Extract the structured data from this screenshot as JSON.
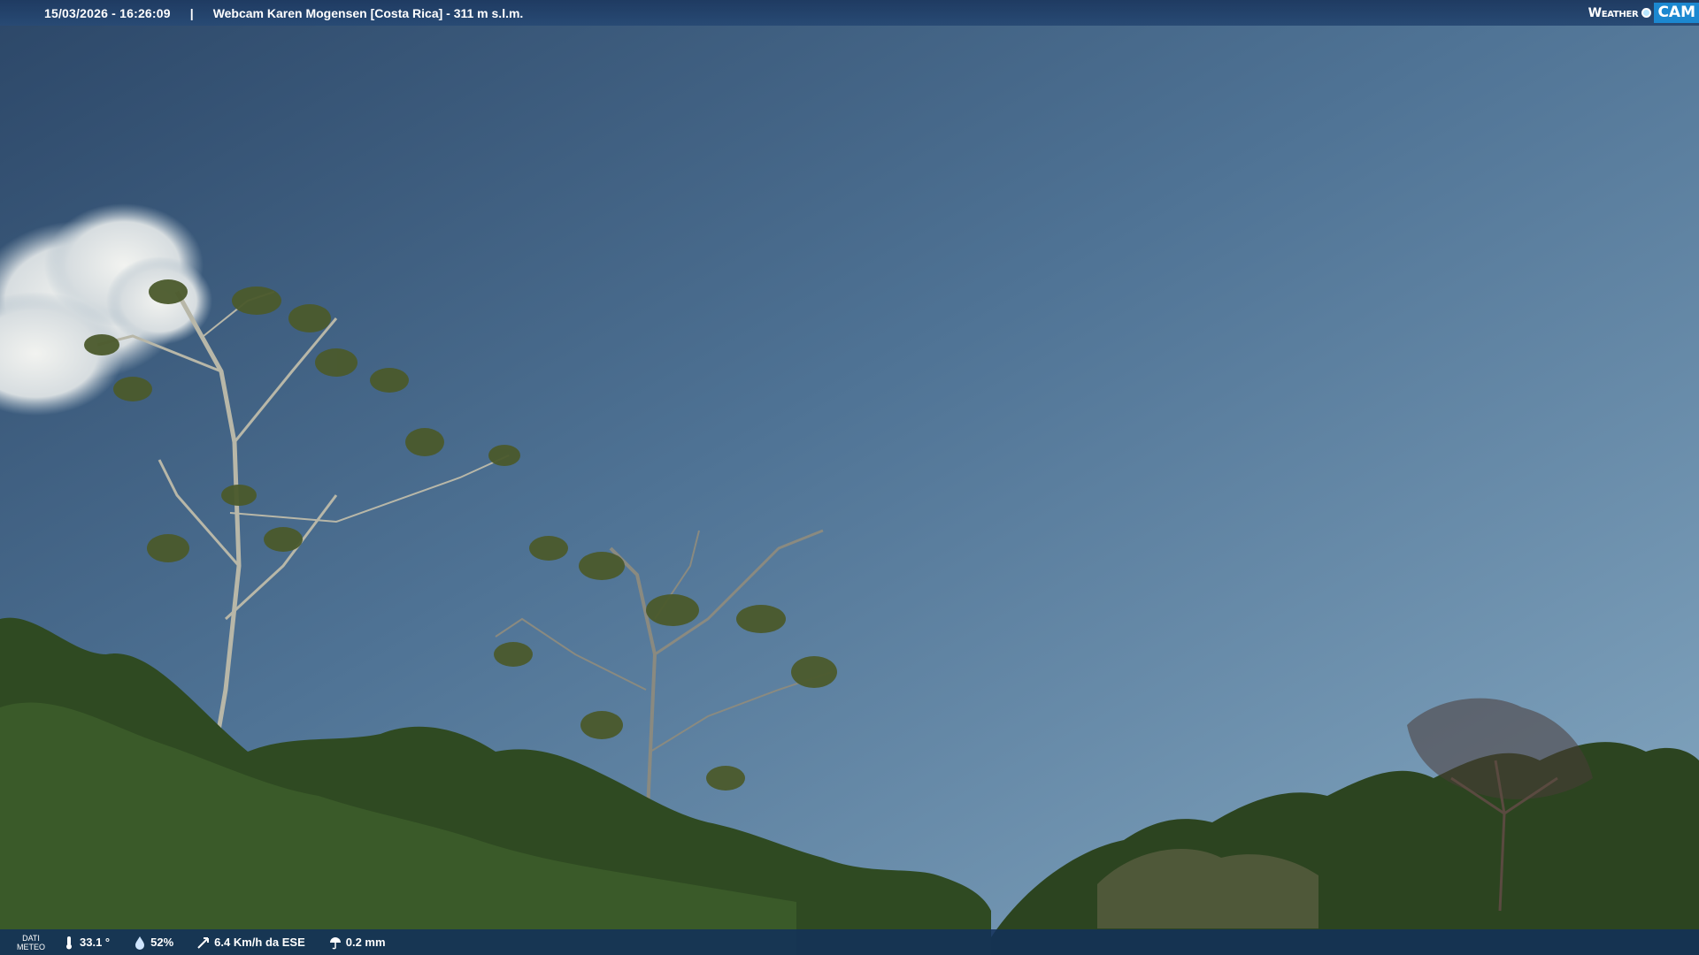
{
  "header": {
    "datetime": "15/03/2026 - 16:26:09",
    "separator": "|",
    "title": "Webcam Karen Mogensen [Costa Rica] - 311 m s.l.m.",
    "logo_weather": "Weather",
    "logo_cam": "CAM"
  },
  "weather": {
    "label_line1": "DATI",
    "label_line2": "METEO",
    "temperature": "33.1 °",
    "humidity": "52%",
    "wind": "6.4 Km/h da ESE",
    "rain": "0.2 mm"
  },
  "colors": {
    "sky_top": "#2f4a6a",
    "sky_bottom": "#7ea2bd",
    "bar": "#1f3b62",
    "logo_accent": "#1c88d0",
    "foliage": "#2e4a22"
  }
}
